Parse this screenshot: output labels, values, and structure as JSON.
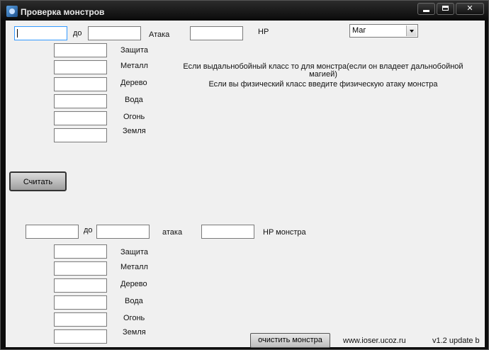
{
  "window": {
    "title": "Проверка монстров",
    "controls": {
      "minimize": "minimize",
      "maximize": "maximize",
      "close": "✕"
    }
  },
  "top_section": {
    "range_sep": "до",
    "attack_label": "Атака",
    "hp_label": "HP",
    "class_select": "Маг",
    "stats": [
      "Защита",
      "Металл",
      "Дерево",
      "Вода",
      "Огонь",
      "Земля"
    ],
    "note_line1": "Если выдальнобойный класс то для монстра(если он владеет дальнобойной",
    "note_line2": "магией)",
    "note_line3": "Если вы физический класс введите физическую атаку монстра",
    "calculate_button": "Считать"
  },
  "bottom_section": {
    "range_sep": "до",
    "attack_label": "атака",
    "hp_label": "HP монстра",
    "stats": [
      "Защита",
      "Металл",
      "Дерево",
      "Вода",
      "Огонь",
      "Земля"
    ],
    "clear_button": "очистить монстра"
  },
  "footer": {
    "site": "www.ioser.ucoz.ru",
    "version": "v1.2 update b"
  }
}
